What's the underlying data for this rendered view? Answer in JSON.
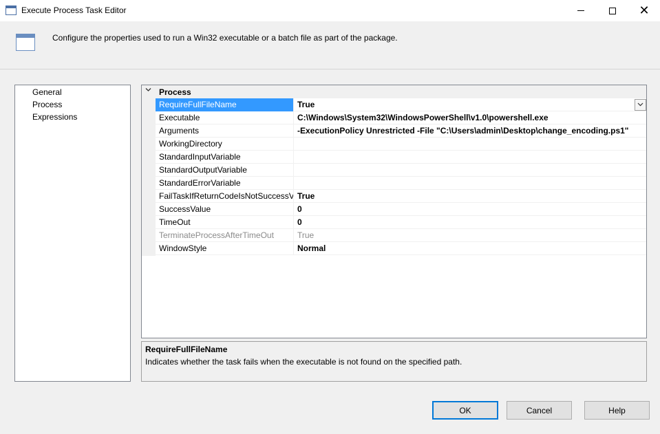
{
  "window": {
    "title": "Execute Process Task Editor"
  },
  "header": {
    "description": "Configure the properties used to run a Win32 executable or a batch file as part of the package."
  },
  "nav": {
    "items": [
      {
        "label": "General"
      },
      {
        "label": "Process"
      },
      {
        "label": "Expressions"
      }
    ]
  },
  "grid": {
    "category": "Process",
    "properties": [
      {
        "name": "RequireFullFileName",
        "value": "True"
      },
      {
        "name": "Executable",
        "value": "C:\\Windows\\System32\\WindowsPowerShell\\v1.0\\powershell.exe"
      },
      {
        "name": "Arguments",
        "value": "-ExecutionPolicy Unrestricted -File  \"C:\\Users\\admin\\Desktop\\change_encoding.ps1\""
      },
      {
        "name": "WorkingDirectory",
        "value": ""
      },
      {
        "name": "StandardInputVariable",
        "value": ""
      },
      {
        "name": "StandardOutputVariable",
        "value": ""
      },
      {
        "name": "StandardErrorVariable",
        "value": ""
      },
      {
        "name": "FailTaskIfReturnCodeIsNotSuccessVal",
        "value": "True"
      },
      {
        "name": "SuccessValue",
        "value": "0"
      },
      {
        "name": "TimeOut",
        "value": "0"
      },
      {
        "name": "TerminateProcessAfterTimeOut",
        "value": "True"
      },
      {
        "name": "WindowStyle",
        "value": "Normal"
      }
    ]
  },
  "description_panel": {
    "title": "RequireFullFileName",
    "text": "Indicates whether the task fails when the executable is not found on the specified path."
  },
  "buttons": {
    "ok": "OK",
    "cancel": "Cancel",
    "help": "Help"
  },
  "colors": {
    "selection": "#3399ff",
    "focus_border": "#0078d7"
  }
}
